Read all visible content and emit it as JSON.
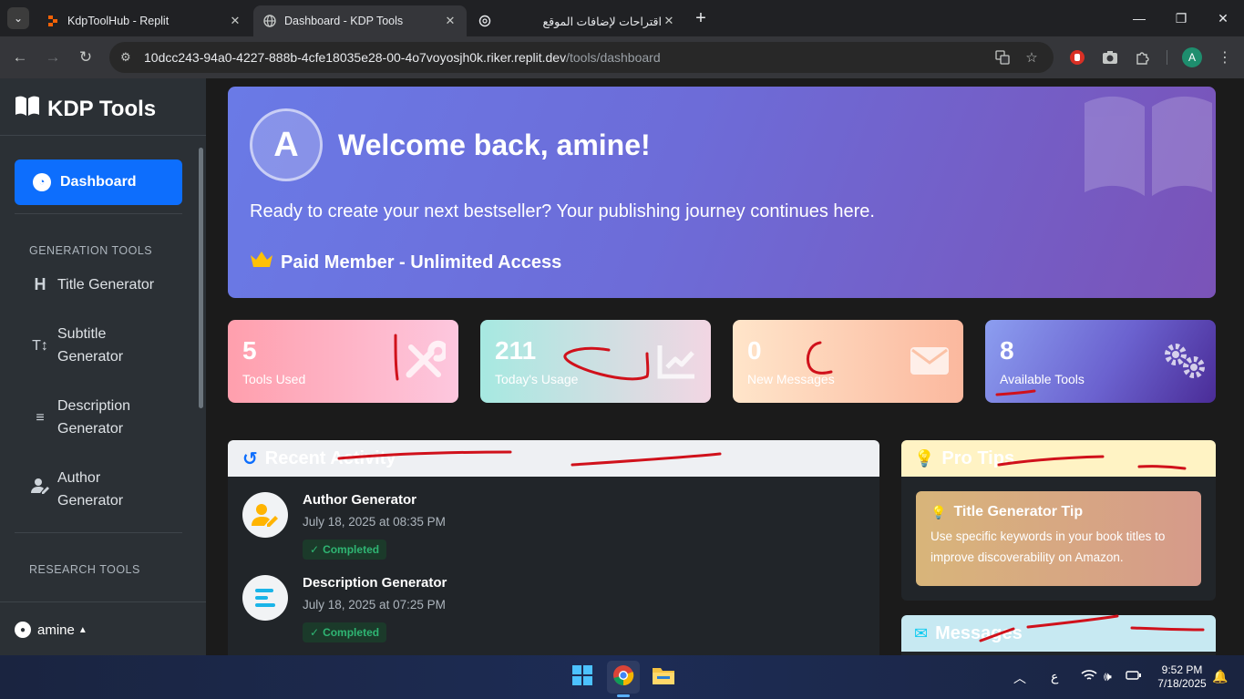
{
  "browser": {
    "tabs": [
      {
        "title": "KdpToolHub - Replit",
        "active": false
      },
      {
        "title": "Dashboard - KDP Tools",
        "active": true
      },
      {
        "title": "اقتراحات لإضافات الموقع",
        "active": false
      }
    ],
    "url_host": "10dcc243-94a0-4227-888b-4cfe18035e28-00-4o7voyosjh0k.riker.replit.dev",
    "url_path": "/tools/dashboard",
    "profile_initial": "A"
  },
  "sidebar": {
    "brand": "KDP Tools",
    "active_item": "Dashboard",
    "section_generation": "GENERATION TOOLS",
    "items": [
      {
        "label": "Title Generator",
        "icon": "heading-icon"
      },
      {
        "label": "Subtitle\nGenerator",
        "icon": "text-height-icon"
      },
      {
        "label": "Description\nGenerator",
        "icon": "align-left-icon"
      },
      {
        "label": "Author\nGenerator",
        "icon": "user-pen-icon"
      }
    ],
    "section_research": "RESEARCH TOOLS",
    "user": "amine"
  },
  "hero": {
    "avatar_initial": "A",
    "title": "Welcome back, amine!",
    "subtitle": "Ready to create your next bestseller? Your publishing journey continues here.",
    "badge": "Paid Member - Unlimited Access"
  },
  "stats": [
    {
      "value": "5",
      "label": "Tools Used",
      "icon": "tools-icon"
    },
    {
      "value": "211",
      "label": "Today's Usage",
      "icon": "chart-line-icon"
    },
    {
      "value": "0",
      "label": "New Messages",
      "icon": "envelope-icon"
    },
    {
      "value": "8",
      "label": "Available Tools",
      "icon": "gears-icon"
    }
  ],
  "recent": {
    "title": "Recent Activity",
    "items": [
      {
        "name": "Author Generator",
        "time": "July 18, 2025 at 08:35 PM",
        "status": "Completed"
      },
      {
        "name": "Description Generator",
        "time": "July 18, 2025 at 07:25 PM",
        "status": "Completed"
      }
    ]
  },
  "tips": {
    "title": "Pro Tips",
    "card_title": "Title Generator Tip",
    "card_text": "Use specific keywords in your book titles to improve discoverability on Amazon."
  },
  "messages": {
    "title": "Messages"
  },
  "taskbar": {
    "lang": "ع",
    "time": "9:52 PM",
    "date": "7/18/2025"
  },
  "colors": {
    "primary": "#0d6efd",
    "sidebar": "#2b3035",
    "hero_start": "#6a7ae6",
    "hero_end": "#7a53b8",
    "annotation_red": "#d0111b"
  }
}
